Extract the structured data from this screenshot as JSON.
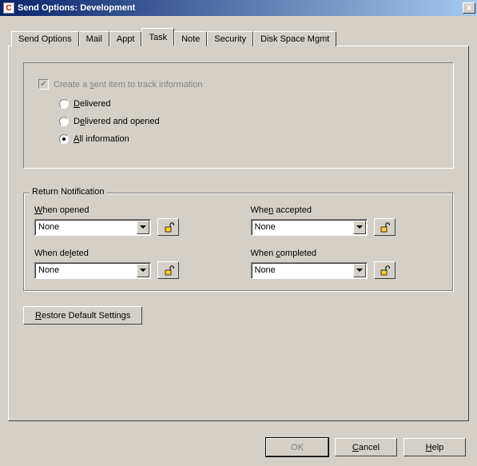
{
  "window": {
    "title": "Send Options:  Development"
  },
  "tabs": [
    {
      "label": "Send Options"
    },
    {
      "label": "Mail"
    },
    {
      "label": "Appt"
    },
    {
      "label": "Task"
    },
    {
      "label": "Note"
    },
    {
      "label": "Security"
    },
    {
      "label": "Disk Space Mgmt"
    }
  ],
  "active_tab_index": 3,
  "tracking": {
    "checkbox_label_pre": "Create a ",
    "checkbox_label_u": "s",
    "checkbox_label_post": "ent item to track information",
    "checked": true,
    "disabled": true,
    "options": [
      {
        "pre": "",
        "u": "D",
        "post": "elivered",
        "checked": false
      },
      {
        "pre": "D",
        "u": "e",
        "post": "livered and opened",
        "checked": false
      },
      {
        "pre": "",
        "u": "A",
        "post": "ll information",
        "checked": true
      }
    ]
  },
  "return_notification": {
    "legend": "Return Notification",
    "fields": [
      {
        "label_pre": "",
        "label_u": "W",
        "label_post": "hen opened",
        "value": "None"
      },
      {
        "label_pre": "Whe",
        "label_u": "n",
        "label_post": " accepted",
        "value": "None"
      },
      {
        "label_pre": "When de",
        "label_u": "l",
        "label_post": "eted",
        "value": "None"
      },
      {
        "label_pre": "When ",
        "label_u": "c",
        "label_post": "ompleted",
        "value": "None"
      }
    ]
  },
  "buttons": {
    "restore_pre": "",
    "restore_u": "R",
    "restore_post": "estore Default Settings",
    "ok": "OK",
    "cancel_pre": "",
    "cancel_u": "C",
    "cancel_post": "ancel",
    "help_pre": "",
    "help_u": "H",
    "help_post": "elp"
  }
}
